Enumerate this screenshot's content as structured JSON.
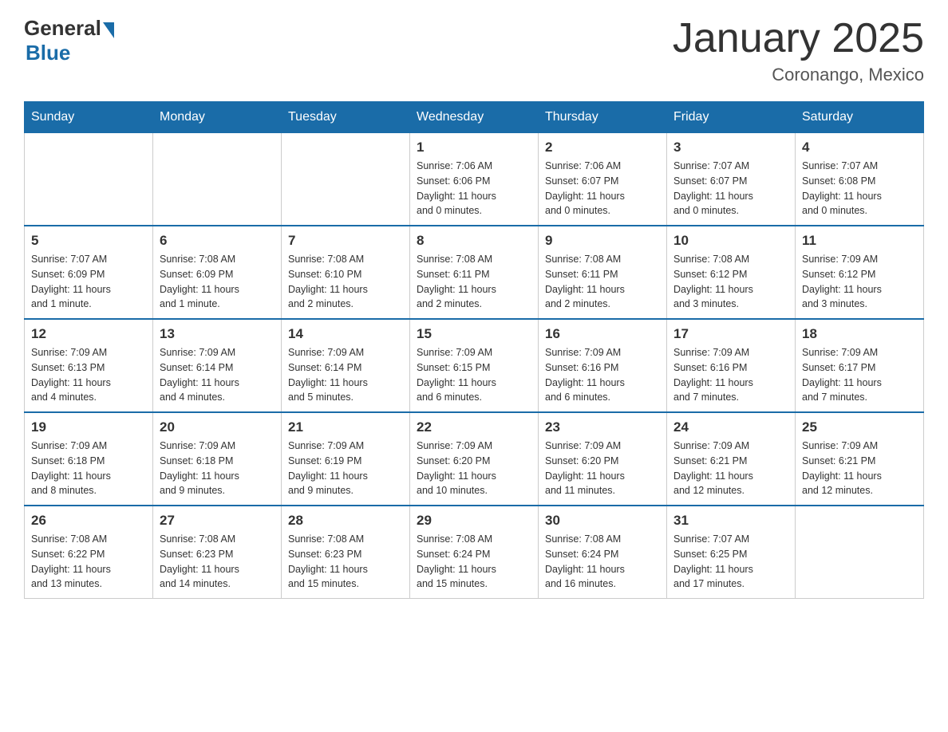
{
  "logo": {
    "general": "General",
    "blue": "Blue"
  },
  "title": "January 2025",
  "subtitle": "Coronango, Mexico",
  "days_of_week": [
    "Sunday",
    "Monday",
    "Tuesday",
    "Wednesday",
    "Thursday",
    "Friday",
    "Saturday"
  ],
  "weeks": [
    [
      {
        "day": "",
        "info": ""
      },
      {
        "day": "",
        "info": ""
      },
      {
        "day": "",
        "info": ""
      },
      {
        "day": "1",
        "info": "Sunrise: 7:06 AM\nSunset: 6:06 PM\nDaylight: 11 hours\nand 0 minutes."
      },
      {
        "day": "2",
        "info": "Sunrise: 7:06 AM\nSunset: 6:07 PM\nDaylight: 11 hours\nand 0 minutes."
      },
      {
        "day": "3",
        "info": "Sunrise: 7:07 AM\nSunset: 6:07 PM\nDaylight: 11 hours\nand 0 minutes."
      },
      {
        "day": "4",
        "info": "Sunrise: 7:07 AM\nSunset: 6:08 PM\nDaylight: 11 hours\nand 0 minutes."
      }
    ],
    [
      {
        "day": "5",
        "info": "Sunrise: 7:07 AM\nSunset: 6:09 PM\nDaylight: 11 hours\nand 1 minute."
      },
      {
        "day": "6",
        "info": "Sunrise: 7:08 AM\nSunset: 6:09 PM\nDaylight: 11 hours\nand 1 minute."
      },
      {
        "day": "7",
        "info": "Sunrise: 7:08 AM\nSunset: 6:10 PM\nDaylight: 11 hours\nand 2 minutes."
      },
      {
        "day": "8",
        "info": "Sunrise: 7:08 AM\nSunset: 6:11 PM\nDaylight: 11 hours\nand 2 minutes."
      },
      {
        "day": "9",
        "info": "Sunrise: 7:08 AM\nSunset: 6:11 PM\nDaylight: 11 hours\nand 2 minutes."
      },
      {
        "day": "10",
        "info": "Sunrise: 7:08 AM\nSunset: 6:12 PM\nDaylight: 11 hours\nand 3 minutes."
      },
      {
        "day": "11",
        "info": "Sunrise: 7:09 AM\nSunset: 6:12 PM\nDaylight: 11 hours\nand 3 minutes."
      }
    ],
    [
      {
        "day": "12",
        "info": "Sunrise: 7:09 AM\nSunset: 6:13 PM\nDaylight: 11 hours\nand 4 minutes."
      },
      {
        "day": "13",
        "info": "Sunrise: 7:09 AM\nSunset: 6:14 PM\nDaylight: 11 hours\nand 4 minutes."
      },
      {
        "day": "14",
        "info": "Sunrise: 7:09 AM\nSunset: 6:14 PM\nDaylight: 11 hours\nand 5 minutes."
      },
      {
        "day": "15",
        "info": "Sunrise: 7:09 AM\nSunset: 6:15 PM\nDaylight: 11 hours\nand 6 minutes."
      },
      {
        "day": "16",
        "info": "Sunrise: 7:09 AM\nSunset: 6:16 PM\nDaylight: 11 hours\nand 6 minutes."
      },
      {
        "day": "17",
        "info": "Sunrise: 7:09 AM\nSunset: 6:16 PM\nDaylight: 11 hours\nand 7 minutes."
      },
      {
        "day": "18",
        "info": "Sunrise: 7:09 AM\nSunset: 6:17 PM\nDaylight: 11 hours\nand 7 minutes."
      }
    ],
    [
      {
        "day": "19",
        "info": "Sunrise: 7:09 AM\nSunset: 6:18 PM\nDaylight: 11 hours\nand 8 minutes."
      },
      {
        "day": "20",
        "info": "Sunrise: 7:09 AM\nSunset: 6:18 PM\nDaylight: 11 hours\nand 9 minutes."
      },
      {
        "day": "21",
        "info": "Sunrise: 7:09 AM\nSunset: 6:19 PM\nDaylight: 11 hours\nand 9 minutes."
      },
      {
        "day": "22",
        "info": "Sunrise: 7:09 AM\nSunset: 6:20 PM\nDaylight: 11 hours\nand 10 minutes."
      },
      {
        "day": "23",
        "info": "Sunrise: 7:09 AM\nSunset: 6:20 PM\nDaylight: 11 hours\nand 11 minutes."
      },
      {
        "day": "24",
        "info": "Sunrise: 7:09 AM\nSunset: 6:21 PM\nDaylight: 11 hours\nand 12 minutes."
      },
      {
        "day": "25",
        "info": "Sunrise: 7:09 AM\nSunset: 6:21 PM\nDaylight: 11 hours\nand 12 minutes."
      }
    ],
    [
      {
        "day": "26",
        "info": "Sunrise: 7:08 AM\nSunset: 6:22 PM\nDaylight: 11 hours\nand 13 minutes."
      },
      {
        "day": "27",
        "info": "Sunrise: 7:08 AM\nSunset: 6:23 PM\nDaylight: 11 hours\nand 14 minutes."
      },
      {
        "day": "28",
        "info": "Sunrise: 7:08 AM\nSunset: 6:23 PM\nDaylight: 11 hours\nand 15 minutes."
      },
      {
        "day": "29",
        "info": "Sunrise: 7:08 AM\nSunset: 6:24 PM\nDaylight: 11 hours\nand 15 minutes."
      },
      {
        "day": "30",
        "info": "Sunrise: 7:08 AM\nSunset: 6:24 PM\nDaylight: 11 hours\nand 16 minutes."
      },
      {
        "day": "31",
        "info": "Sunrise: 7:07 AM\nSunset: 6:25 PM\nDaylight: 11 hours\nand 17 minutes."
      },
      {
        "day": "",
        "info": ""
      }
    ]
  ]
}
